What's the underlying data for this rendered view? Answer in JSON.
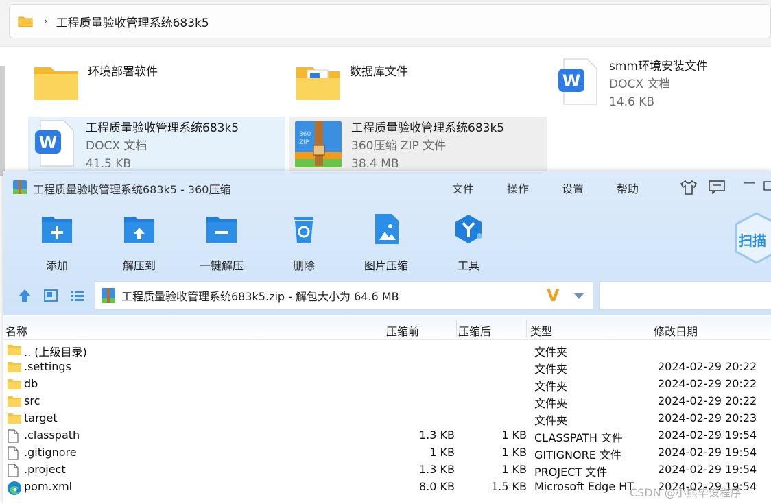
{
  "explorer": {
    "breadcrumb": "工程质量验收管理系统683k5",
    "items": [
      {
        "name": "环境部署软件",
        "sub1": "",
        "sub2": ""
      },
      {
        "name": "数据库文件",
        "sub1": "",
        "sub2": ""
      },
      {
        "name": "smm环境安装文件",
        "sub1": "DOCX 文档",
        "sub2": "14.6 KB"
      },
      {
        "name": "工程质量验收管理系统683k5",
        "sub1": "DOCX 文档",
        "sub2": "41.5 KB"
      },
      {
        "name": "工程质量验收管理系统683k5",
        "sub1": "360压缩 ZIP 文件",
        "sub2": "38.4 MB"
      }
    ]
  },
  "window": {
    "title": "工程质量验收管理系统683k5 - 360压缩",
    "menu": [
      "文件",
      "操作",
      "设置",
      "帮助"
    ],
    "tools": [
      "添加",
      "解压到",
      "一键解压",
      "删除",
      "图片压缩",
      "工具"
    ],
    "scan_label": "扫描",
    "path_text": "工程质量验收管理系统683k5.zip - 解包大小为 64.6 MB",
    "columns": [
      "名称",
      "压缩前",
      "压缩后",
      "类型",
      "修改日期"
    ],
    "rows": [
      {
        "icon": "folder",
        "name": ".. (上级目录)",
        "pre": "",
        "post": "",
        "type": "文件夹",
        "date": ""
      },
      {
        "icon": "folder",
        "name": ".settings",
        "pre": "",
        "post": "",
        "type": "文件夹",
        "date": "2024-02-29 20:22"
      },
      {
        "icon": "folder",
        "name": "db",
        "pre": "",
        "post": "",
        "type": "文件夹",
        "date": "2024-02-29 20:22"
      },
      {
        "icon": "folder",
        "name": "src",
        "pre": "",
        "post": "",
        "type": "文件夹",
        "date": "2024-02-29 20:22"
      },
      {
        "icon": "folder",
        "name": "target",
        "pre": "",
        "post": "",
        "type": "文件夹",
        "date": "2024-02-29 20:23"
      },
      {
        "icon": "file",
        "name": ".classpath",
        "pre": "1.3 KB",
        "post": "1 KB",
        "type": "CLASSPATH 文件",
        "date": "2024-02-29 19:54"
      },
      {
        "icon": "file",
        "name": ".gitignore",
        "pre": "1 KB",
        "post": "1 KB",
        "type": "GITIGNORE 文件",
        "date": "2024-02-29 19:54"
      },
      {
        "icon": "file",
        "name": ".project",
        "pre": "1.3 KB",
        "post": "1 KB",
        "type": "PROJECT 文件",
        "date": "2024-02-29 19:54"
      },
      {
        "icon": "edge",
        "name": "pom.xml",
        "pre": "8.0 KB",
        "post": "1.5 KB",
        "type": "Microsoft Edge HT",
        "date": "2024-02-29 19:54"
      }
    ]
  },
  "watermark": "CSDN @小熊毕设程序",
  "colors": {
    "folder": "#f6c342",
    "accent": "#2b8fe8",
    "header_bg": "#d6e8fa",
    "word_blue": "#2d7be5"
  }
}
